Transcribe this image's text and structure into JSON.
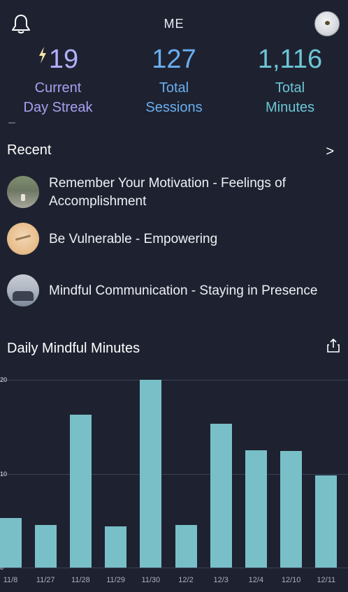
{
  "header": {
    "title": "ME"
  },
  "stats": {
    "streak": {
      "value": "19",
      "label_line1": "Current",
      "label_line2": "Day Streak"
    },
    "sessions": {
      "value": "127",
      "label_line1": "Total",
      "label_line2": "Sessions"
    },
    "minutes": {
      "value": "1,116",
      "label_line1": "Total",
      "label_line2": "Minutes"
    }
  },
  "recent": {
    "title": "Recent",
    "chevron": ">",
    "items": [
      {
        "label": "Remember Your Motivation - Feelings of Accomplishment"
      },
      {
        "label": "Be Vulnerable - Empowering"
      },
      {
        "label": "Mindful Communication - Staying in Presence"
      }
    ]
  },
  "daily": {
    "title": "Daily Mindful Minutes"
  },
  "colors": {
    "background": "#1e2230",
    "bar": "#79bfc8",
    "streak": "#b3b0ff",
    "sessions": "#6aaef0",
    "minutes": "#6cc6d6"
  },
  "chart_data": {
    "type": "bar",
    "title": "Daily Mindful Minutes",
    "categories": [
      "11/8",
      "11/27",
      "11/28",
      "11/29",
      "11/30",
      "12/2",
      "12/3",
      "12/4",
      "12/10",
      "12/11"
    ],
    "values": [
      5.3,
      4.5,
      16.3,
      4.4,
      20,
      4.5,
      15.3,
      12.5,
      12.4,
      9.8
    ],
    "yticks": [
      "0",
      "10",
      "20"
    ],
    "ylim": [
      0,
      20
    ],
    "grid": true
  }
}
